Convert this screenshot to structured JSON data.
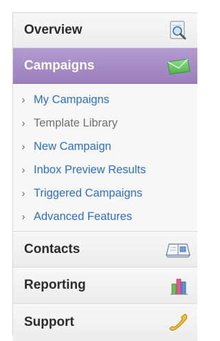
{
  "nav": {
    "sections": {
      "overview": {
        "label": "Overview",
        "icon": "magnifier-document-icon"
      },
      "campaigns": {
        "label": "Campaigns",
        "icon": "envelope-icon"
      },
      "contacts": {
        "label": "Contacts",
        "icon": "address-book-icon"
      },
      "reporting": {
        "label": "Reporting",
        "icon": "bar-chart-icon"
      },
      "support": {
        "label": "Support",
        "icon": "phone-icon"
      }
    },
    "campaigns_submenu": [
      {
        "label": "My Campaigns",
        "enabled": true
      },
      {
        "label": "Template Library",
        "enabled": false
      },
      {
        "label": "New Campaign",
        "enabled": true
      },
      {
        "label": "Inbox Preview Results",
        "enabled": true
      },
      {
        "label": "Triggered Campaigns",
        "enabled": true
      },
      {
        "label": "Advanced Features",
        "enabled": true
      }
    ],
    "colors": {
      "active_bg": "#a68cc8",
      "link": "#2a6fc9",
      "disabled": "#6f6f6f"
    }
  }
}
